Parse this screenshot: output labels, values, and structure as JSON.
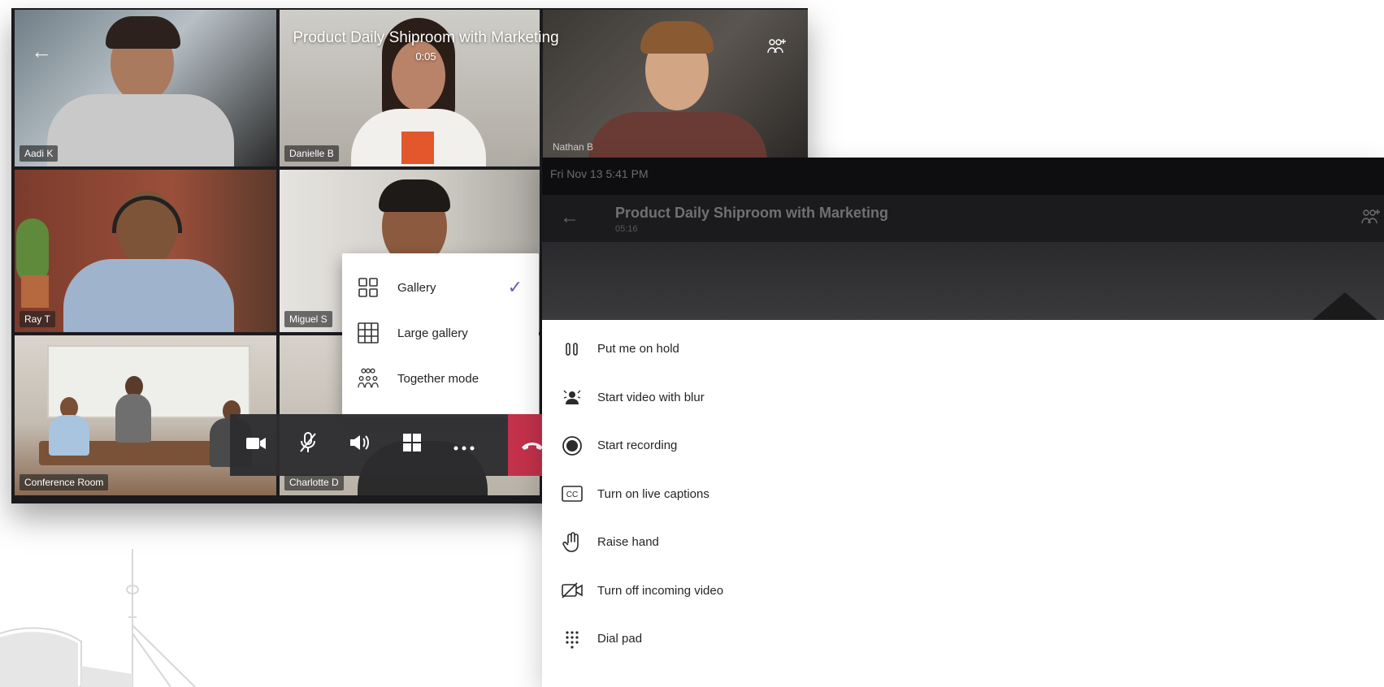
{
  "gallery_call": {
    "meeting_title": "Product Daily Shiproom with Marketing",
    "call_timer": "0:05",
    "participants": [
      {
        "name": "Aadi K"
      },
      {
        "name": "Danielle B"
      },
      {
        "name": "Nathan B"
      },
      {
        "name": "Ray T"
      },
      {
        "name": "Miguel S"
      },
      {
        "name": "Conference Room"
      },
      {
        "name": "Charlotte D"
      }
    ],
    "view_menu": {
      "items": [
        {
          "label": "Gallery",
          "icon": "gallery-grid-icon",
          "selected": true
        },
        {
          "label": "Large gallery",
          "icon": "large-gallery-grid-icon",
          "selected": false
        },
        {
          "label": "Together mode",
          "icon": "together-mode-icon",
          "selected": false
        }
      ]
    },
    "controls": [
      {
        "icon": "camera-icon"
      },
      {
        "icon": "mic-off-icon"
      },
      {
        "icon": "speaker-icon"
      },
      {
        "icon": "layout-grid-icon"
      },
      {
        "icon": "more-options-icon"
      },
      {
        "icon": "hang-up-icon"
      }
    ],
    "accent_color": "#6264a7",
    "hangup_color": "#c4314b"
  },
  "tablet_call": {
    "status_datetime": "Fri Nov 13  5:41 PM",
    "meeting_title": "Product Daily Shiproom with Marketing",
    "call_timer": "05:16",
    "more_actions": [
      {
        "label": "Put me on hold",
        "icon": "hold-icon"
      },
      {
        "label": "Start video with blur",
        "icon": "blur-video-icon"
      },
      {
        "label": "Start recording",
        "icon": "record-icon"
      },
      {
        "label": "Turn on live captions",
        "icon": "captions-icon"
      },
      {
        "label": "Raise hand",
        "icon": "raise-hand-icon"
      },
      {
        "label": "Turn off incoming video",
        "icon": "video-off-icon"
      },
      {
        "label": "Dial pad",
        "icon": "dial-pad-icon"
      }
    ]
  }
}
